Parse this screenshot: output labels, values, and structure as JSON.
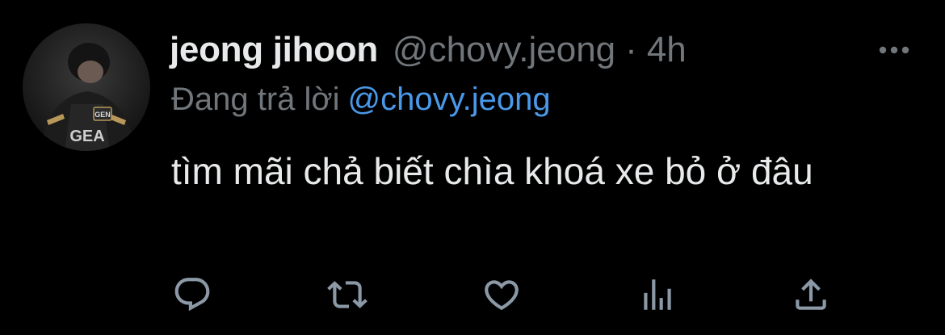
{
  "tweet": {
    "display_name": "jeong jihoon",
    "handle": "@chovy.jeong",
    "separator": "·",
    "time": "4h",
    "reply_prefix": "Đang trả lời",
    "reply_to": "@chovy.jeong",
    "text": "tìm mãi chả biết chìa khoá xe bỏ ở đâu"
  },
  "avatar": {
    "logo_text": "GEN",
    "jersey_letters": "GEA"
  },
  "actions": [
    {
      "name": "reply-icon"
    },
    {
      "name": "retweet-icon"
    },
    {
      "name": "like-icon"
    },
    {
      "name": "views-icon"
    },
    {
      "name": "share-icon"
    }
  ],
  "colors": {
    "background": "#000000",
    "primary_text": "#e7e9ea",
    "secondary_text": "#71767b",
    "link": "#4a99e9"
  }
}
